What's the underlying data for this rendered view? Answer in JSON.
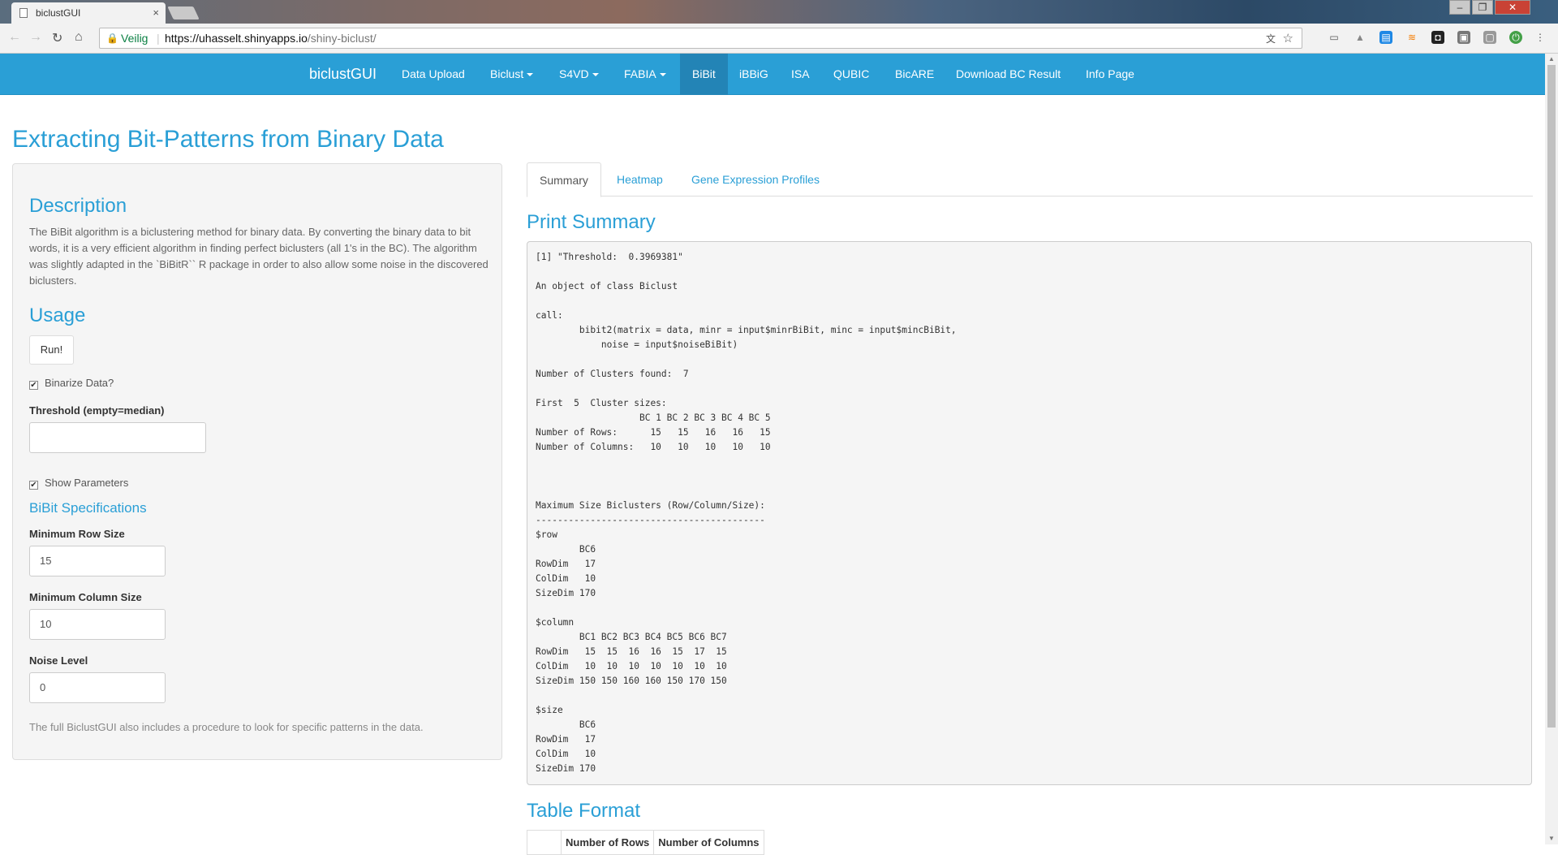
{
  "browser": {
    "tab_title": "biclustGUI",
    "tab_close": "×",
    "secure_label": "Veilig",
    "url_host": "https://uhasselt.shinyapps.io",
    "url_path": "/shiny-biclust/"
  },
  "navbar": {
    "brand": "biclustGUI",
    "items": [
      "Data Upload",
      "Biclust",
      "S4VD",
      "FABIA",
      "BiBit",
      "iBBiG",
      "ISA",
      "QUBIC",
      "BicARE",
      "Download BC Result",
      "Info Page"
    ],
    "active": "BiBit"
  },
  "page": {
    "title": "Extracting Bit-Patterns from Binary Data"
  },
  "sidebar": {
    "description_heading": "Description",
    "description": "The BiBit algorithm is a biclustering method for binary data. By converting the binary data to bit words, it is a very efficient algorithm in finding perfect biclusters (all 1's in the BC). The algorithm was slightly adapted in the `BiBitR`` R package in order to also allow some noise in the discovered biclusters.",
    "usage_heading": "Usage",
    "run_button": "Run!",
    "binarize_label": "Binarize Data?",
    "binarize_checked": true,
    "threshold_label": "Threshold (empty=median)",
    "threshold_value": "",
    "show_params_label": "Show Parameters",
    "show_params_checked": true,
    "spec_heading": "BiBit Specifications",
    "min_row_label": "Minimum Row Size",
    "min_row_value": "15",
    "min_col_label": "Minimum Column Size",
    "min_col_value": "10",
    "noise_label": "Noise Level",
    "noise_value": "0",
    "footnote": "The full BiclustGUI also includes a procedure to look for specific patterns in the data."
  },
  "main": {
    "tabs": [
      "Summary",
      "Heatmap",
      "Gene Expression Profiles"
    ],
    "active_tab": "Summary",
    "print_summary_heading": "Print Summary",
    "summary_text": "[1] \"Threshold:  0.3969381\"\n\nAn object of class Biclust\n\ncall:\n\tbibit2(matrix = data, minr = input$minrBiBit, minc = input$mincBiBit,\n\t    noise = input$noiseBiBit)\n\nNumber of Clusters found:  7\n\nFirst  5  Cluster sizes:\n                   BC 1 BC 2 BC 3 BC 4 BC 5\nNumber of Rows:      15   15   16   16   15\nNumber of Columns:   10   10   10   10   10\n\n\n\nMaximum Size Biclusters (Row/Column/Size):\n------------------------------------------\n$row\n        BC6\nRowDim   17\nColDim   10\nSizeDim 170\n\n$column\n        BC1 BC2 BC3 BC4 BC5 BC6 BC7\nRowDim   15  15  16  16  15  17  15\nColDim   10  10  10  10  10  10  10\nSizeDim 150 150 160 160 150 170 150\n\n$size\n        BC6\nRowDim   17\nColDim   10\nSizeDim 170",
    "table_heading": "Table Format",
    "table_headers": [
      "",
      "Number of Rows",
      "Number of Columns"
    ]
  },
  "colors": {
    "primary": "#2a9fd6",
    "navbar_active": "#2384b6"
  }
}
